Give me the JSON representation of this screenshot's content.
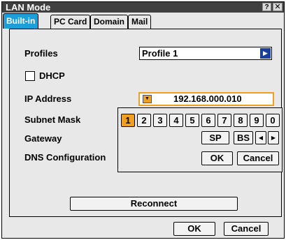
{
  "window": {
    "title": "LAN Mode",
    "help_label": "?",
    "close_label": "✕"
  },
  "tabs": [
    {
      "label": "Built-in"
    },
    {
      "label": "PC Card"
    },
    {
      "label": "Domain"
    },
    {
      "label": "Mail"
    }
  ],
  "form": {
    "profiles_label": "Profiles",
    "profile_value": "Profile 1",
    "dhcp_label": "DHCP",
    "ip_label": "IP Address",
    "ip_value": "192.168.000.010",
    "subnet_label": "Subnet Mask",
    "gateway_label": "Gateway",
    "dns_label": "DNS Configuration"
  },
  "keypad": {
    "digits": [
      "1",
      "2",
      "3",
      "4",
      "5",
      "6",
      "7",
      "8",
      "9",
      "0"
    ],
    "selected": "1",
    "sp_label": "SP",
    "bs_label": "BS",
    "left_arrow": "◀",
    "right_arrow": "▶",
    "ok_label": "OK",
    "cancel_label": "Cancel"
  },
  "footer": {
    "reconnect_label": "Reconnect",
    "ok_label": "OK",
    "cancel_label": "Cancel"
  }
}
